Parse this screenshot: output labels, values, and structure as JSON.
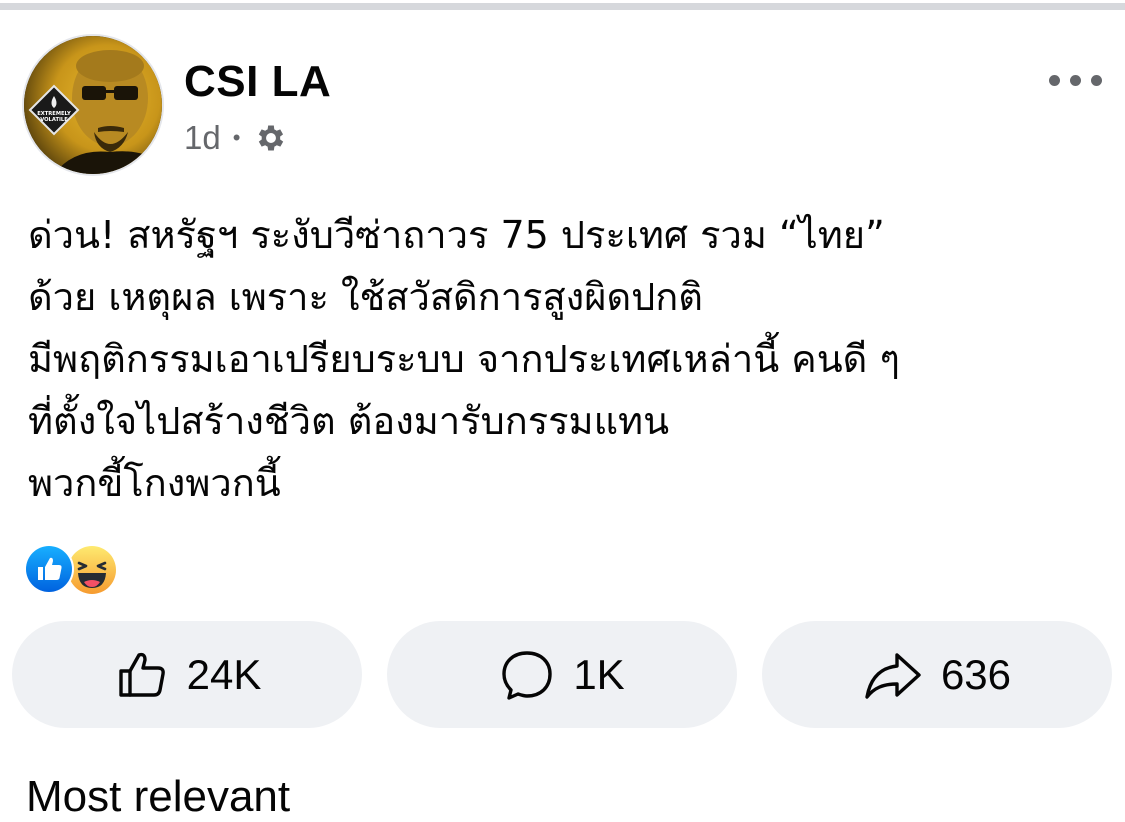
{
  "post": {
    "author": "CSI LA",
    "timestamp": "1d",
    "separator": "•",
    "privacy_icon": "gear-icon",
    "avatar_badge_text": "EXTREMELY VOLATILE",
    "more_icon": "more-dots-icon",
    "text_lines": [
      "ด่วน! สหรัฐฯ ระงับวีซ่าถาวร 75 ประเทศ รวม “ไทย”",
      "ด้วย เหตุผล เพราะ ใช้สวัสดิการสูงผิดปกติ",
      "มีพฤติกรรมเอาเปรียบระบบ จากประเทศเหล่านี้ คนดี ๆ",
      "ที่ตั้งใจไปสร้างชีวิต ต้องมารับกรรมแทน",
      "พวกขี้โกงพวกนี้"
    ]
  },
  "reactions": {
    "icons": [
      "like-reaction-icon",
      "haha-reaction-icon"
    ],
    "colors": {
      "like": "#1877f2",
      "haha": "#f7b125"
    }
  },
  "actions": {
    "like_count": "24K",
    "comment_count": "1K",
    "share_count": "636"
  },
  "section": {
    "heading_partial": "Most relevant"
  }
}
